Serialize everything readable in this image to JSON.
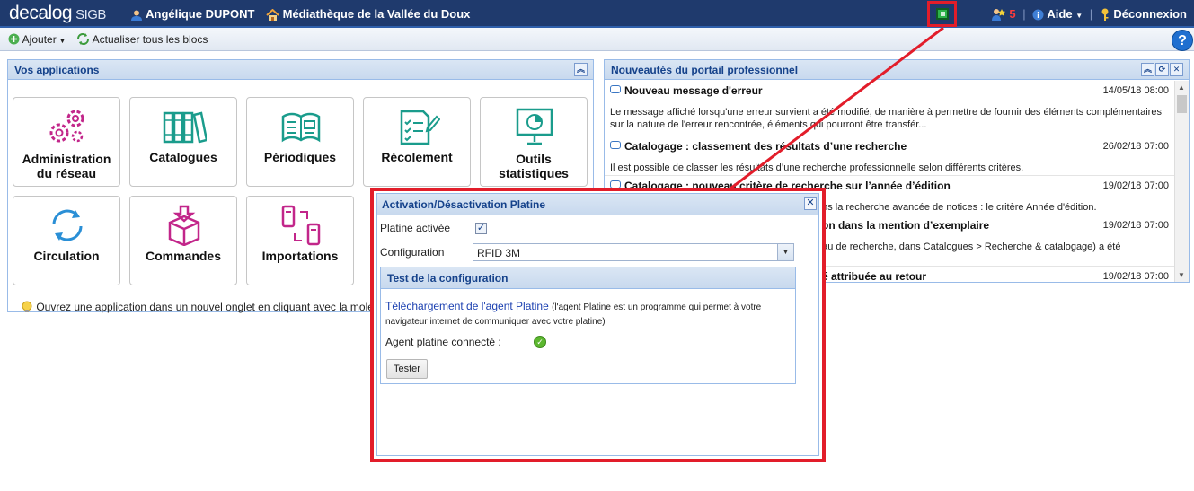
{
  "header": {
    "logo_main": "decalog",
    "logo_sub": "SIGB",
    "user_name": "Angélique DUPONT",
    "library_name": "Médiathèque de la Vallée du Doux",
    "notifications_count": "5",
    "help_label": "Aide",
    "logout_label": "Déconnexion"
  },
  "toolbar": {
    "add_label": "Ajouter",
    "refresh_label": "Actualiser tous les blocs",
    "help_button": "?"
  },
  "apps_panel": {
    "title": "Vos applications",
    "tiles": [
      {
        "label": "Administration du réseau",
        "icon": "gears-icon"
      },
      {
        "label": "Catalogues",
        "icon": "books-icon"
      },
      {
        "label": "Périodiques",
        "icon": "newspaper-icon"
      },
      {
        "label": "Récolement",
        "icon": "checklist-icon"
      },
      {
        "label": "Outils statistiques",
        "icon": "chart-board-icon"
      },
      {
        "label": "Circulation",
        "icon": "refresh-arrows-icon"
      },
      {
        "label": "Commandes",
        "icon": "box-icon"
      },
      {
        "label": "Importations",
        "icon": "transfer-icon"
      }
    ],
    "hint": "Ouvrez une application dans un nouvel onglet en cliquant avec la molet"
  },
  "news_panel": {
    "title": "Nouveautés du portail professionnel",
    "items": [
      {
        "title": "Nouveau message d'erreur",
        "date": "14/05/18 08:00",
        "desc": "Le message affiché lorsqu'une erreur survient a été modifié, de manière à permettre de fournir des éléments complémentaires sur la nature de l'erreur rencontrée, éléments qui pourront être transfér..."
      },
      {
        "title": "Catalogage : classement des résultats d’une recherche",
        "date": "26/02/18 07:00",
        "desc": "Il est possible de classer les résultats d’une recherche professionnelle selon différents critères."
      },
      {
        "title": "Catalogage : nouveau critère de recherche sur l’année d’édition",
        "date": "19/02/18 07:00",
        "desc": "ans la recherche avancée de notices : le critère Année d'édition."
      },
      {
        "title": "on dans la mention d’exemplaire",
        "date": "19/02/18 07:00",
        "desc": "eau de recherche, dans Catalogues > Recherche & catalogage) a été"
      },
      {
        "title": "é attribuée au retour",
        "date": "19/02/18 07:00",
        "desc": ""
      }
    ]
  },
  "dialog": {
    "title": "Activation/Désactivation Platine",
    "platine_active_label": "Platine activée",
    "platine_active_checked": "✓",
    "configuration_label": "Configuration",
    "configuration_value": "RFID 3M",
    "test_section_title": "Test de la configuration",
    "download_link": "Téléchargement de l'agent Platine",
    "download_note": "(l'agent Platine est un programme qui permet à votre navigateur internet de communiquer avec votre platine)",
    "agent_status_label": "Agent platine connecté :",
    "test_button": "Tester"
  },
  "colors": {
    "topbar": "#1f3a6d",
    "highlight_red": "#e21d2a",
    "panel_title": "#15428b",
    "ok_green": "#5cb72f"
  }
}
